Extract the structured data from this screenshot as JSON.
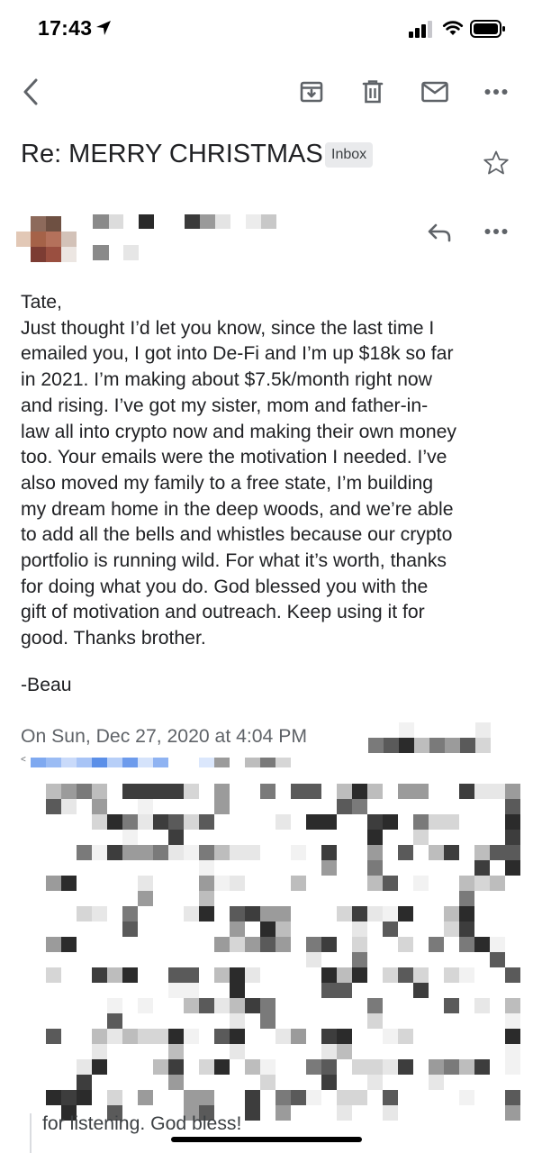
{
  "status_bar": {
    "time": "17:43"
  },
  "icons": {
    "back": "back-arrow-icon",
    "archive": "archive-icon",
    "delete": "trash-icon",
    "mark_unread": "mail-icon",
    "more": "more-horizontal-icon",
    "star": "star-icon",
    "reply": "reply-icon"
  },
  "email": {
    "subject": "Re: MERRY CHRISTMAS",
    "label": "Inbox",
    "body": [
      "Tate,",
      "Just thought I’d let you know, since the last time I",
      "emailed you, I got into De-Fi and I’m up $18k so far",
      "in 2021. I’m making about $7.5k/month right now",
      "and rising. I’ve got my sister, mom and father-in-",
      "law all into crypto now and making their own money",
      "too. Your emails were the motivation I needed. I’ve",
      "also moved my family to a free state, I’m building",
      "my dream home in the deep woods, and we’re able",
      "to add all the bells and whistles because our crypto",
      "portfolio is running wild. For what it’s worth, thanks",
      "for doing what you do. God blessed you with the",
      "gift of motivation and outreach. Keep using it for",
      "good. Thanks brother."
    ],
    "signoff": "-Beau",
    "quote_header": "On Sun, Dec 27, 2020 at 4:04 PM",
    "quote_bracket": "<",
    "quoted_last_line": "for listening. God bless!"
  },
  "colors": {
    "text": "#202124",
    "secondary": "#5f6368",
    "icon": "#5f6368",
    "chip_bg": "#e9eaec"
  }
}
